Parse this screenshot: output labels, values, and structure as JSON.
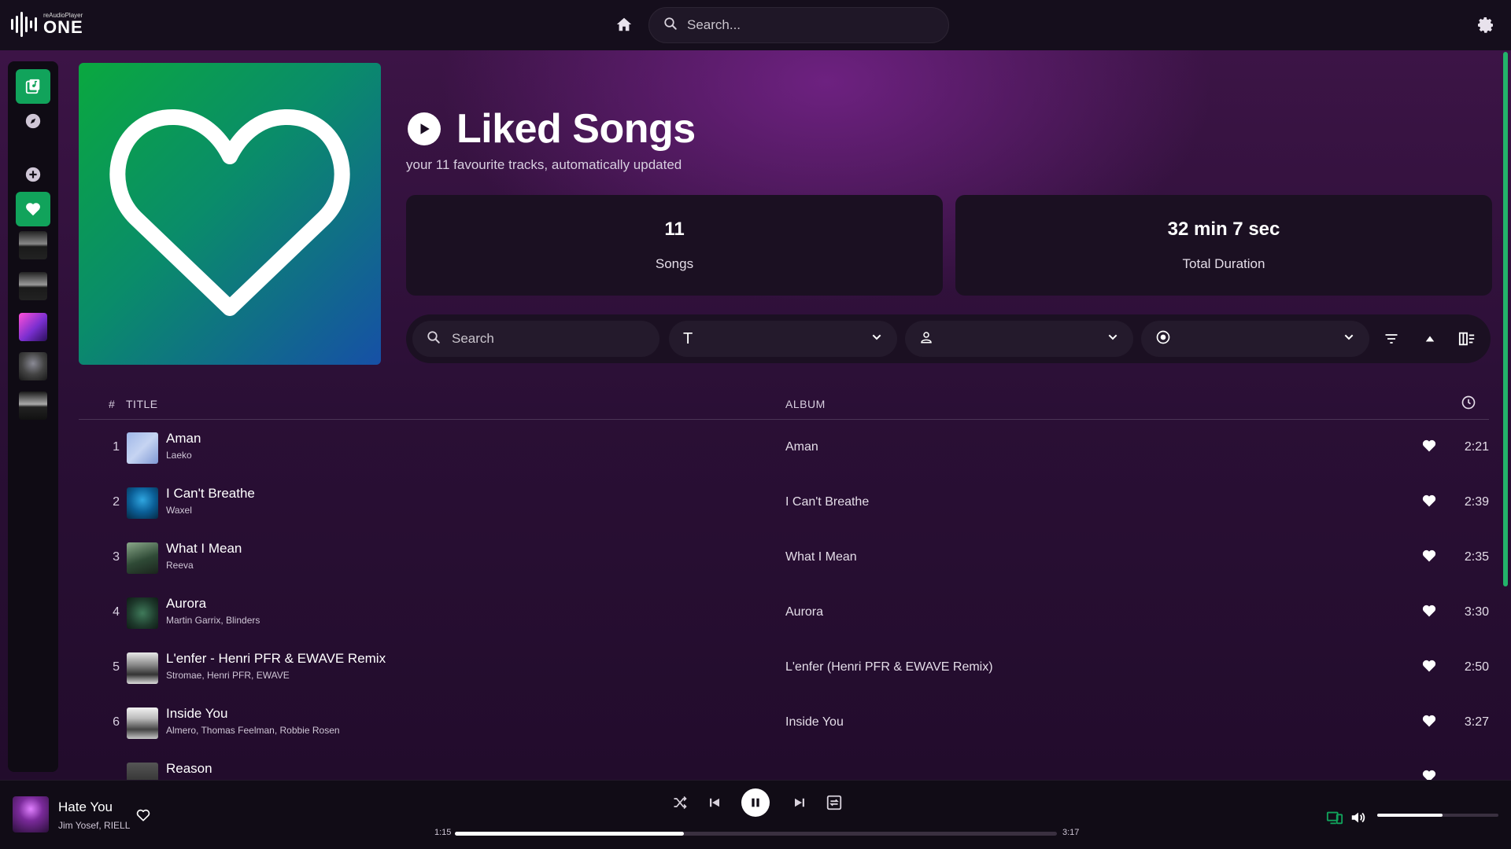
{
  "app": {
    "logo_small": "reAudioPlayer",
    "logo_big": "ONE"
  },
  "header": {
    "search_placeholder": "Search..."
  },
  "playlist": {
    "title": "Liked Songs",
    "subtitle": "your 11 favourite tracks, automatically updated",
    "stats": {
      "songs_value": "11",
      "songs_label": "Songs",
      "duration_value": "32 min 7 sec",
      "duration_label": "Total Duration"
    }
  },
  "filters": {
    "search_placeholder": "Search",
    "title_glyph": "T"
  },
  "table": {
    "col_num": "#",
    "col_title": "TITLE",
    "col_album": "ALBUM",
    "rows": [
      {
        "num": "1",
        "title": "Aman",
        "artist": "Laeko",
        "album": "Aman",
        "duration": "2:21"
      },
      {
        "num": "2",
        "title": "I Can't Breathe",
        "artist": "Waxel",
        "album": "I Can't Breathe",
        "duration": "2:39"
      },
      {
        "num": "3",
        "title": "What I Mean",
        "artist": "Reeva",
        "album": "What I Mean",
        "duration": "2:35"
      },
      {
        "num": "4",
        "title": "Aurora",
        "artist": "Martin Garrix, Blinders",
        "album": "Aurora",
        "duration": "3:30"
      },
      {
        "num": "5",
        "title": "L'enfer - Henri PFR & EWAVE Remix",
        "artist": "Stromae, Henri PFR, EWAVE",
        "album": "L'enfer (Henri PFR & EWAVE Remix)",
        "duration": "2:50"
      },
      {
        "num": "6",
        "title": "Inside You",
        "artist": "Almero, Thomas Feelman, Robbie Rosen",
        "album": "Inside You",
        "duration": "3:27"
      },
      {
        "num": "",
        "title": "Reason",
        "artist": "",
        "album": "",
        "duration": ""
      }
    ]
  },
  "player": {
    "title": "Hate You",
    "artist": "Jim Yosef, RIELL",
    "elapsed": "1:15",
    "total": "3:17",
    "progress_fraction": 0.38,
    "volume_fraction": 0.54
  },
  "colors": {
    "accent": "#11a35b",
    "heart": "#ffffff"
  },
  "icons": [
    "home-icon",
    "search-icon",
    "gear-icon",
    "library-icon",
    "compass-icon",
    "add-icon",
    "heart-icon",
    "play-icon",
    "chevron-down-icon",
    "person-icon",
    "record-icon",
    "filter-icon",
    "triangle-up-icon",
    "columns-icon",
    "clock-icon",
    "shuffle-icon",
    "previous-icon",
    "pause-icon",
    "next-icon",
    "repeat-icon",
    "devices-icon",
    "volume-icon"
  ]
}
